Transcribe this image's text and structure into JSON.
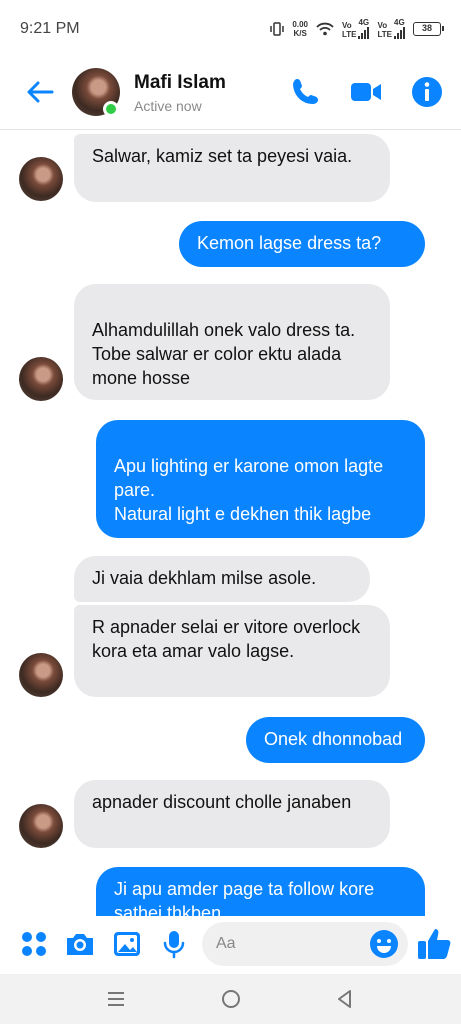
{
  "status_bar": {
    "time": "9:21 PM",
    "net_speed_value": "0.00",
    "net_speed_unit": "K/S",
    "sim1_top": "Vo",
    "sim1_bottom": "LTE",
    "sim1_gen": "4G",
    "sim2_top": "Vo",
    "sim2_bottom": "LTE",
    "sim2_gen": "4G",
    "battery": "38"
  },
  "header": {
    "name": "Mafi Islam",
    "status": "Active now",
    "accent_color": "#0b84ff"
  },
  "messages": [
    {
      "side": "received",
      "text": "Salwar, kamiz set ta peyesi vaia."
    },
    {
      "side": "sent",
      "text": "Kemon lagse dress ta?"
    },
    {
      "side": "received",
      "text": "Alhamdulillah onek valo dress ta.\nTobe salwar er color ektu alada mone hosse"
    },
    {
      "side": "sent",
      "text": "Apu lighting er karone omon lagte pare.\nNatural light e dekhen thik lagbe"
    },
    {
      "side": "received",
      "text": "Ji vaia dekhlam milse asole."
    },
    {
      "side": "received",
      "text": "R apnader selai er vitore overlock kora eta amar valo lagse."
    },
    {
      "side": "sent",
      "text": "Onek dhonnobad"
    },
    {
      "side": "received",
      "text": "apnader discount cholle janaben"
    },
    {
      "side": "sent",
      "text": "Ji apu amder page ta follow kore sathei thkben"
    }
  ],
  "composer": {
    "placeholder": "Aa",
    "icons": [
      "menu-dots-icon",
      "camera-icon",
      "gallery-icon",
      "microphone-icon",
      "emoji-icon",
      "thumbs-up-icon"
    ]
  },
  "nav": {
    "icons": [
      "recent-apps-icon",
      "home-icon",
      "back-icon"
    ]
  }
}
